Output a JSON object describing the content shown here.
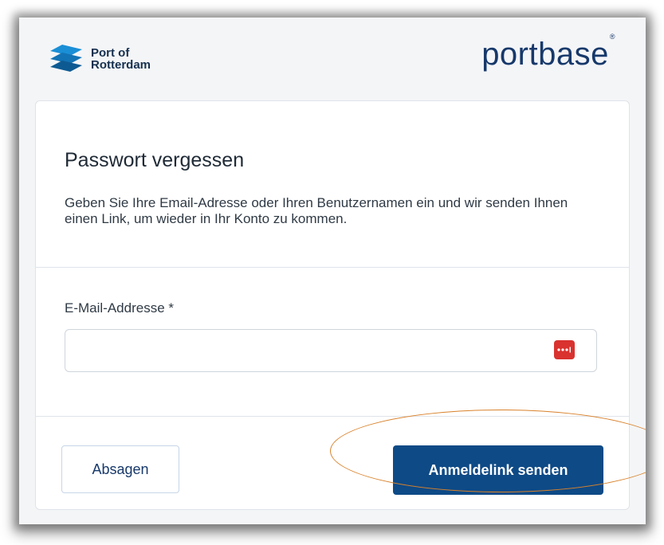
{
  "header": {
    "left_logo_text": "Port of\nRotterdam",
    "left_logo_icon": "port-of-rotterdam-waves-icon",
    "right_logo_text": "portbase",
    "right_logo_mark": "®",
    "brand_color": "#17396b"
  },
  "form": {
    "title": "Passwort vergessen",
    "description": "Geben Sie Ihre Email-Adresse oder Ihren Benutzernamen ein und wir senden Ihnen einen Link, um wieder in Ihr Konto zu kommen.",
    "email_label": "E-Mail-Addresse *",
    "email_value": "",
    "email_placeholder": "",
    "password_manager_icon": "password-manager-dots-icon",
    "cancel_label": "Absagen",
    "submit_label": "Anmeldelink senden",
    "submit_color": "#0e4a86",
    "highlight_color": "#d9822b"
  }
}
